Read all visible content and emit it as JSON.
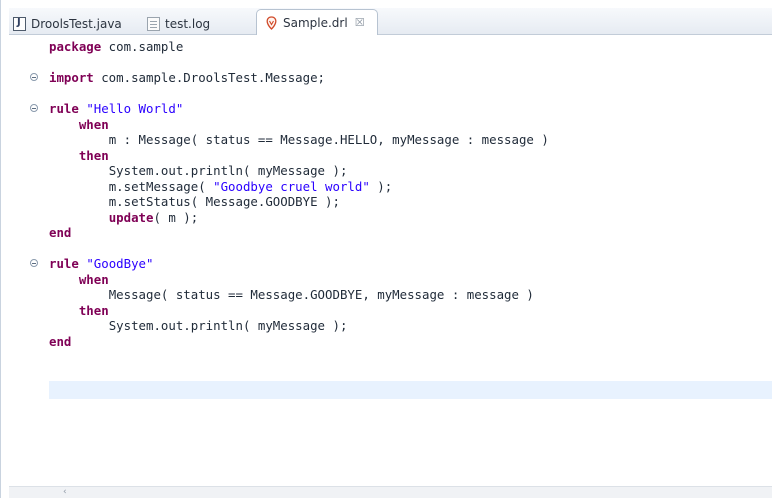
{
  "tabs": [
    {
      "label": "DroolsTest.java",
      "icon": "java-file-icon",
      "active": false
    },
    {
      "label": "test.log",
      "icon": "text-file-icon",
      "active": false
    },
    {
      "label": "Sample.drl",
      "icon": "drools-file-icon",
      "active": true,
      "close": "☒"
    }
  ],
  "colors": {
    "keyword": "#7f0055",
    "string": "#2a00ff",
    "current_line": "#e8f2fe",
    "tab_bar": "#e6ebf2"
  },
  "code": {
    "l1": {
      "kw": "package",
      "rest": " com.sample"
    },
    "l3": {
      "kw": "import",
      "rest": " com.sample.DroolsTest.Message;"
    },
    "l5": {
      "kw": "rule",
      "str": "\"Hello World\""
    },
    "l6": {
      "kw": "when"
    },
    "l7": {
      "text": "m : Message( status == Message.HELLO, myMessage : message )"
    },
    "l8": {
      "kw": "then"
    },
    "l9": {
      "text": "System.out.println( myMessage );"
    },
    "l10": {
      "pre": "m.setMessage( ",
      "str": "\"Goodbye cruel world\"",
      "post": " );"
    },
    "l11": {
      "text": "m.setStatus( Message.GOODBYE );"
    },
    "l12": {
      "kw": "update",
      "post": "( m );"
    },
    "l13": {
      "kw": "end"
    },
    "l15": {
      "kw": "rule",
      "str": "\"GoodBye\""
    },
    "l16": {
      "kw": "when"
    },
    "l17": {
      "text": "Message( status == Message.GOODBYE, myMessage : message )"
    },
    "l18": {
      "kw": "then"
    },
    "l19": {
      "text": "System.out.println( myMessage );"
    },
    "l20": {
      "kw": "end"
    }
  },
  "scrollbar": {
    "left_arrow": "‹"
  }
}
